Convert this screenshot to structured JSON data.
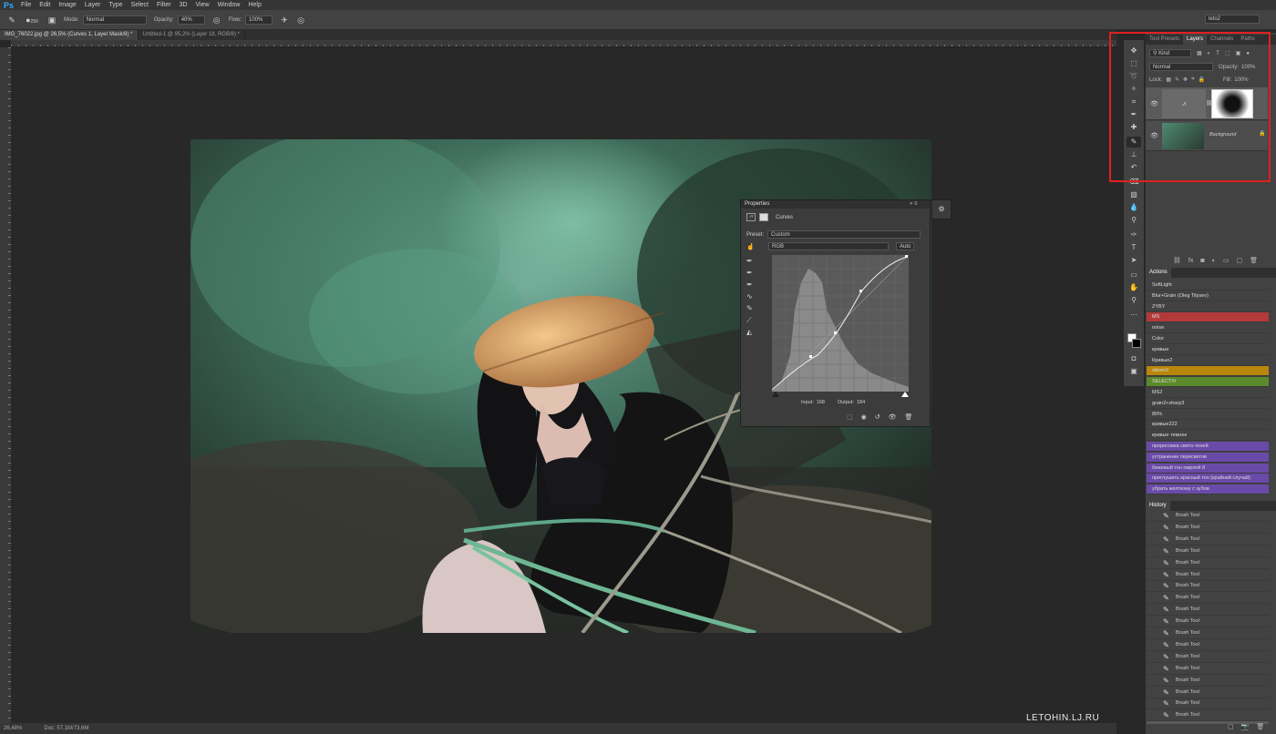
{
  "app": {
    "logo": "Ps"
  },
  "menu": [
    "File",
    "Edit",
    "Image",
    "Layer",
    "Type",
    "Select",
    "Filter",
    "3D",
    "View",
    "Window",
    "Help"
  ],
  "options": {
    "brush_size": "250",
    "mode_label": "Mode:",
    "mode_value": "Normal",
    "opacity_label": "Opacity:",
    "opacity_value": "40%",
    "flow_label": "Flow:",
    "flow_value": "100%",
    "workspace": "leto2"
  },
  "doc_tabs": [
    {
      "label": "IMG_76022.jpg @ 26,5% (Curves 1, Layer Mask/8) *",
      "active": true
    },
    {
      "label": "Untitled-1 @ 95,2% (Layer 18, RGB/8) *",
      "active": false
    }
  ],
  "status": {
    "zoom": "26,48%",
    "doc": "Doc: 57,1M/73,6M"
  },
  "watermark": "LETOHIN.LJ.RU",
  "properties": {
    "title": "Properties",
    "adj_name": "Curves",
    "preset_label": "Preset:",
    "preset_value": "Custom",
    "channel": "RGB",
    "auto": "Auto",
    "input_label": "Input:",
    "input_value": "168",
    "output_label": "Output:",
    "output_value": "184"
  },
  "layers_panel": {
    "tabs": [
      "Tool Presets",
      "Layers",
      "Channels",
      "Paths"
    ],
    "active_tab": "Layers",
    "kind": "Kind",
    "blend": "Normal",
    "opacity_label": "Opacity:",
    "opacity_value": "100%",
    "lock_label": "Lock:",
    "fill_label": "Fill:",
    "fill_value": "100%",
    "background_name": "Background"
  },
  "actions": {
    "title": "Actions",
    "items": [
      {
        "label": "SoftLight",
        "color": ""
      },
      {
        "label": "Blur+Grain (Oleg Titysev)",
        "color": ""
      },
      {
        "label": "ZYBY",
        "color": ""
      },
      {
        "label": "MS",
        "color": "#b43a3a"
      },
      {
        "label": "noise",
        "color": ""
      },
      {
        "label": "Color",
        "color": ""
      },
      {
        "label": "кривые",
        "color": ""
      },
      {
        "label": "Кривые2",
        "color": ""
      },
      {
        "label": "obiom2",
        "color": "#b8860b"
      },
      {
        "label": "SELECTIV",
        "color": "#5a8a2a"
      },
      {
        "label": "MS2",
        "color": ""
      },
      {
        "label": "grain2+sharp3",
        "color": ""
      },
      {
        "label": "80%",
        "color": ""
      },
      {
        "label": "кривые222",
        "color": ""
      },
      {
        "label": "кривые темнее",
        "color": ""
      },
      {
        "label": "прорисовка свето-теней",
        "color": "#6a4aa8"
      },
      {
        "label": "устранение пересветов",
        "color": "#6a4aa8"
      },
      {
        "label": "бежевый тон омрлей 8",
        "color": "#6a4aa8"
      },
      {
        "label": "приглушить красный тон (крайний случай)",
        "color": "#6a4aa8"
      },
      {
        "label": "убрать желтизну с зубов",
        "color": "#6a4aa8"
      }
    ]
  },
  "history": {
    "title": "History",
    "items": [
      "Brush Tool",
      "Brush Tool",
      "Brush Tool",
      "Brush Tool",
      "Brush Tool",
      "Brush Tool",
      "Brush Tool",
      "Brush Tool",
      "Brush Tool",
      "Brush Tool",
      "Brush Tool",
      "Brush Tool",
      "Brush Tool",
      "Brush Tool",
      "Brush Tool",
      "Brush Tool",
      "Brush Tool",
      "Brush Tool",
      "Brush Tool"
    ]
  }
}
